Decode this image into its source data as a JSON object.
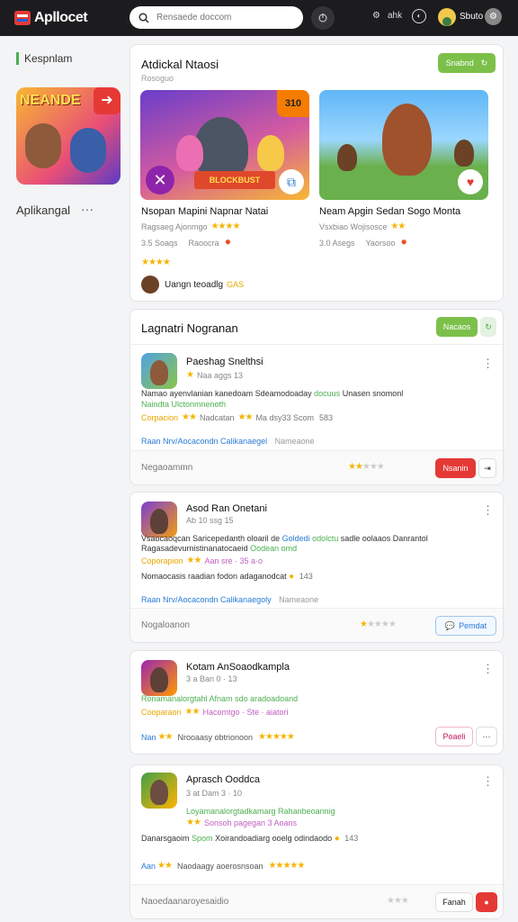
{
  "topbar": {
    "app_title": "Apllocet",
    "search_placeholder": "Rensaede doccom",
    "small_label": "ahk",
    "user_name": "Sbuto"
  },
  "sidebar": {
    "heading": "Kespnlam",
    "thumb_title": "NEANDE",
    "label": "Aplikangal",
    "more": "···"
  },
  "featured": {
    "title": "Atdickal Ntaosi",
    "subtitle": "Rosoguo",
    "button": "Snabnd",
    "games": [
      {
        "name": "Nsopan Mapini Napnar Natai",
        "meta": "Ragsaeg Ajonmgo",
        "stat1": "3.5 Soaqs",
        "stat2": "Raoocra",
        "corner": "310"
      },
      {
        "name": "Neam Apgin Sedan Sogo Monta",
        "meta": "Vsxbiao Wojisosce",
        "stat1": "3.0 Asegs",
        "stat2": "Yaorsoo",
        "corner": ""
      }
    ],
    "rating_stars": "★★★★",
    "dev_name": "Uangn teoadlg",
    "dev_tag": "GAS"
  },
  "lead": {
    "title": "Lagnatri Nogranan",
    "button": "Nacaos",
    "app": {
      "name": "Paeshag Snelthsi",
      "sub": "Naa aggs 13",
      "desc1": "Namao ayenvlanian kanedoam Sdeamodoaday",
      "desc1_green": "docuus",
      "desc1_end": "Unasen snomonl",
      "desc2": "Naindta Ulctonmnenoth",
      "meta_orange": "Corpacion",
      "meta_mid": "Nadcatan",
      "meta_end": "Ma dsy33 Scom",
      "meta_num": "583",
      "link": "Raan Nrv/Aocacondn Calikanaegel",
      "link_end": "Nameaone",
      "footer_text": "Negaoammn",
      "footer_button": "Nsanin",
      "footer_icon": "⇥"
    }
  },
  "apps": [
    {
      "name": "Asod Ran Onetani",
      "sub": "Ab 10 ssg 15",
      "desc1": "Vsaocaoqcan Saricepedanth oloaril de",
      "desc1_blue": "Goldedi",
      "desc1_green": "odolctu",
      "desc1_end": "sadle oolaaos Danrantol",
      "desc2": "Ragasadevurnistinanatocaeid",
      "desc2_green": "Oodean omd",
      "meta_orange": "Coporapion",
      "meta_mid": "Aan sre · 35 a·o",
      "line3": "Nomaocasis raadian fodon adaganodcat",
      "line3_num": "143",
      "link": "Raan Nrv/Aocacondn Calikanaegoly",
      "link_end": "Nameaone",
      "footer_text": "Nogaloanon",
      "footer_button": "Pemdat"
    },
    {
      "name": "Kotam AnSoaodkampla",
      "sub": "3 a Ban 0 · 13",
      "desc1": "Ronamanalorgtahl Afnam sdo aradoadoand",
      "meta_orange": "Cooparaon",
      "meta_mid": "Hacomtgo · Ste · aiatori",
      "tag_left": "Nan",
      "tag_mid": "Nrooaasy obtrionoon",
      "footer_button": "Poaeli",
      "footer_more": "···"
    },
    {
      "name": "Aprasch Ooddca",
      "sub": "3 at Dam 3 · 10",
      "desc1": "Loyamanalorgtadkamarg Rahanbeoannig",
      "meta_mid": "Sonsoh pagegan 3 Aoans",
      "line3_left": "Danarsgaoim",
      "line3_green": "Spom",
      "line3": "Xoirandoadiarg ooelg odindaodo",
      "line3_num": "143",
      "tag_left": "Aan",
      "tag_mid": "Naodaagy aoerosnsoan",
      "footer_text": "Naoedaanaroyesaidio",
      "footer_button": "Fanah"
    }
  ]
}
